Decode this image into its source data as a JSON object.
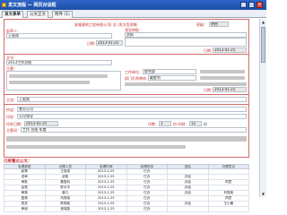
{
  "window": {
    "title": "发文流程 — 网页对话框",
    "minimize": "_",
    "maximize": "□",
    "close": "×"
  },
  "tabs": [
    "发文表单",
    "公文正文",
    "附件 (1)"
  ],
  "form": {
    "org_name": "安顺建筑工程有限公司( 总 )发文签发稿",
    "secret_label": "密级：",
    "secret_value": "明密",
    "drafter_label": "起草人：",
    "drafter_value": "王若成",
    "leader_label": "领导审批：",
    "leader_value": "武彬",
    "date_label1": "日期：",
    "date_value1": "2013-01-25",
    "date_label2": "日期：",
    "date_value2": "2013-01-25",
    "no_label": "文号：",
    "no_value": "2013工作总结",
    "title_label": "主题：",
    "work_unit_label": "工作单位：",
    "work_unit_value": "综合部",
    "dept_label": "部门负责审核：",
    "dept_value": "戴胜利",
    "date_label3": "日期：",
    "date_value3": "2013-01-25",
    "main_send_label": "主送：",
    "main_send_value": "王若成",
    "cc_label": "抄送：",
    "cc_value": "各分公司",
    "print_label": "印发：",
    "print_value": "公司领导",
    "print_date_label": "印发日期：",
    "print_date_value": "2013-01-25",
    "copies_label": "印数：",
    "copies_value": "1",
    "pages_label": "份   印制：",
    "pages_value": "12",
    "pages_unit": "份",
    "keywords_label": "主题词：",
    "keywords_value": "工作  总结  年度"
  },
  "history_title": "已经看过公文：",
  "history": {
    "columns": [
      "处理类型",
      "办理人员",
      "处理时间",
      "处理状态",
      "送给",
      "办理意见"
    ],
    "rows": [
      [
        "起草",
        "王若成",
        "2013-1-25",
        "已办",
        "",
        ""
      ],
      [
        "送审",
        "武彬",
        "2013-1-25",
        "已办",
        "办结",
        ""
      ],
      [
        "审批",
        "戴胜利",
        "2013-1-25",
        "已办",
        "办结",
        "同意"
      ],
      [
        "会签",
        "陈长平",
        "2013-1-25",
        "已办",
        "办结",
        ""
      ],
      [
        "审核",
        "曾凡",
        "2013-1-25",
        "已办",
        "办结",
        "刘秀英"
      ],
      [
        "复核",
        "刘秀英",
        "2013-1-25",
        "已办",
        "",
        "同意"
      ],
      [
        "签发",
        "陈明成",
        "2013-1-25",
        "已办",
        "办结",
        "王小果"
      ],
      [
        "审阅",
        "宫瑞英",
        "2013-1-25",
        "已办",
        "",
        ""
      ]
    ]
  },
  "scroll": {
    "up": "▲",
    "down": "▼"
  }
}
